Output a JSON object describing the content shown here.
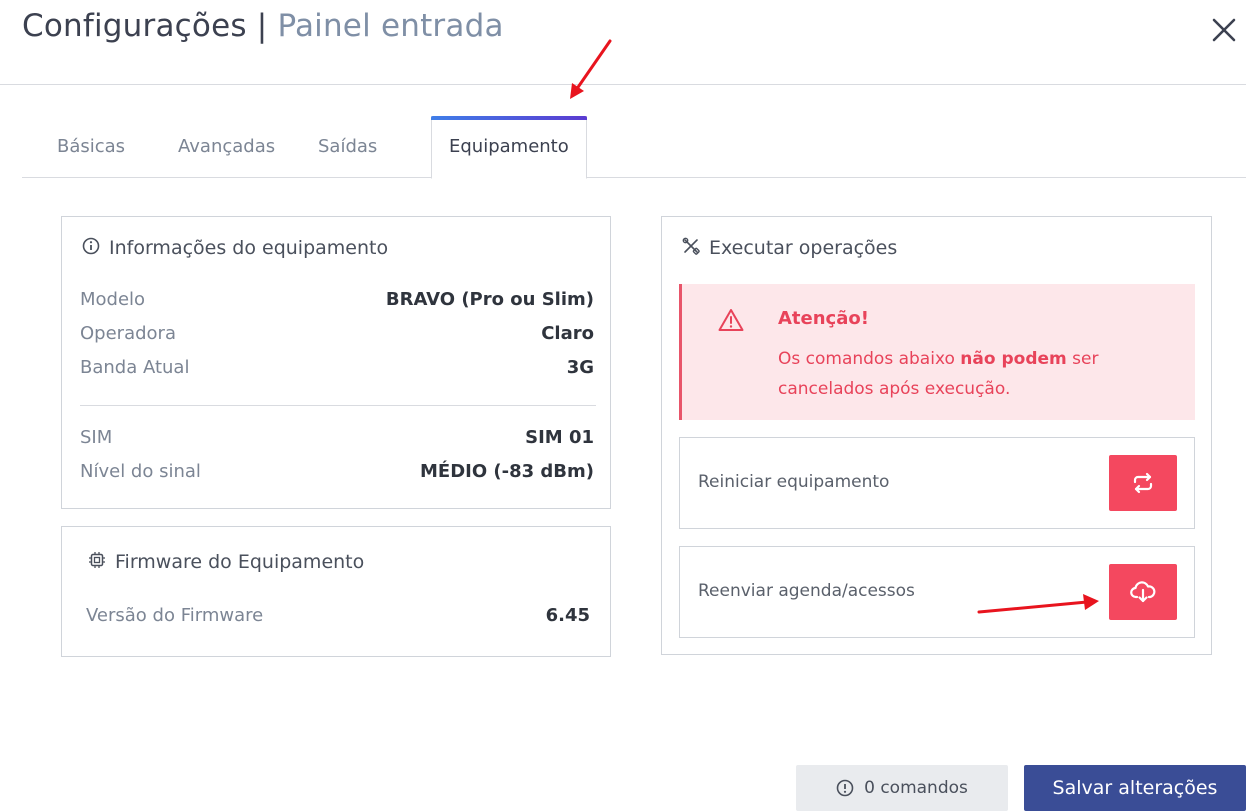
{
  "header": {
    "title": "Configurações |",
    "subtitle": "Painel entrada"
  },
  "tabs": [
    {
      "label": "Básicas",
      "active": false
    },
    {
      "label": "Avançadas",
      "active": false
    },
    {
      "label": "Saídas",
      "active": false
    },
    {
      "label": "Equipamento",
      "active": true
    }
  ],
  "info_card": {
    "title": "Informações do equipamento",
    "icon": "info-circle-icon",
    "rows": [
      {
        "label": "Modelo",
        "value": "BRAVO (Pro ou Slim)"
      },
      {
        "label": "Operadora",
        "value": "Claro"
      },
      {
        "label": "Banda Atual",
        "value": "3G"
      },
      {
        "label": "SIM",
        "value": "SIM 01"
      },
      {
        "label": "Nível do sinal",
        "value": "MÉDIO (-83 dBm)"
      }
    ]
  },
  "firmware_card": {
    "title": "Firmware do Equipamento",
    "icon": "chip-icon",
    "label": "Versão do Firmware",
    "value": "6.45"
  },
  "operations_card": {
    "title": "Executar operações",
    "icon": "tools-icon",
    "alert": {
      "title": "Atenção!",
      "text_before": "Os comandos abaixo ",
      "text_bold": "não podem",
      "text_after": " ser cancelados após execução.",
      "icon": "warning-triangle-icon"
    },
    "operations": [
      {
        "label": "Reiniciar equipamento",
        "icon": "repeat-icon"
      },
      {
        "label": "Reenviar agenda/acessos",
        "icon": "cloud-download-icon"
      }
    ]
  },
  "footer": {
    "commands_label": "0 comandos",
    "save_label": "Salvar alterações"
  },
  "colors": {
    "accent": "#3a4d96",
    "danger": "#f4485f",
    "alert_bg": "#fde7ea",
    "annotation": "#e8141e"
  }
}
